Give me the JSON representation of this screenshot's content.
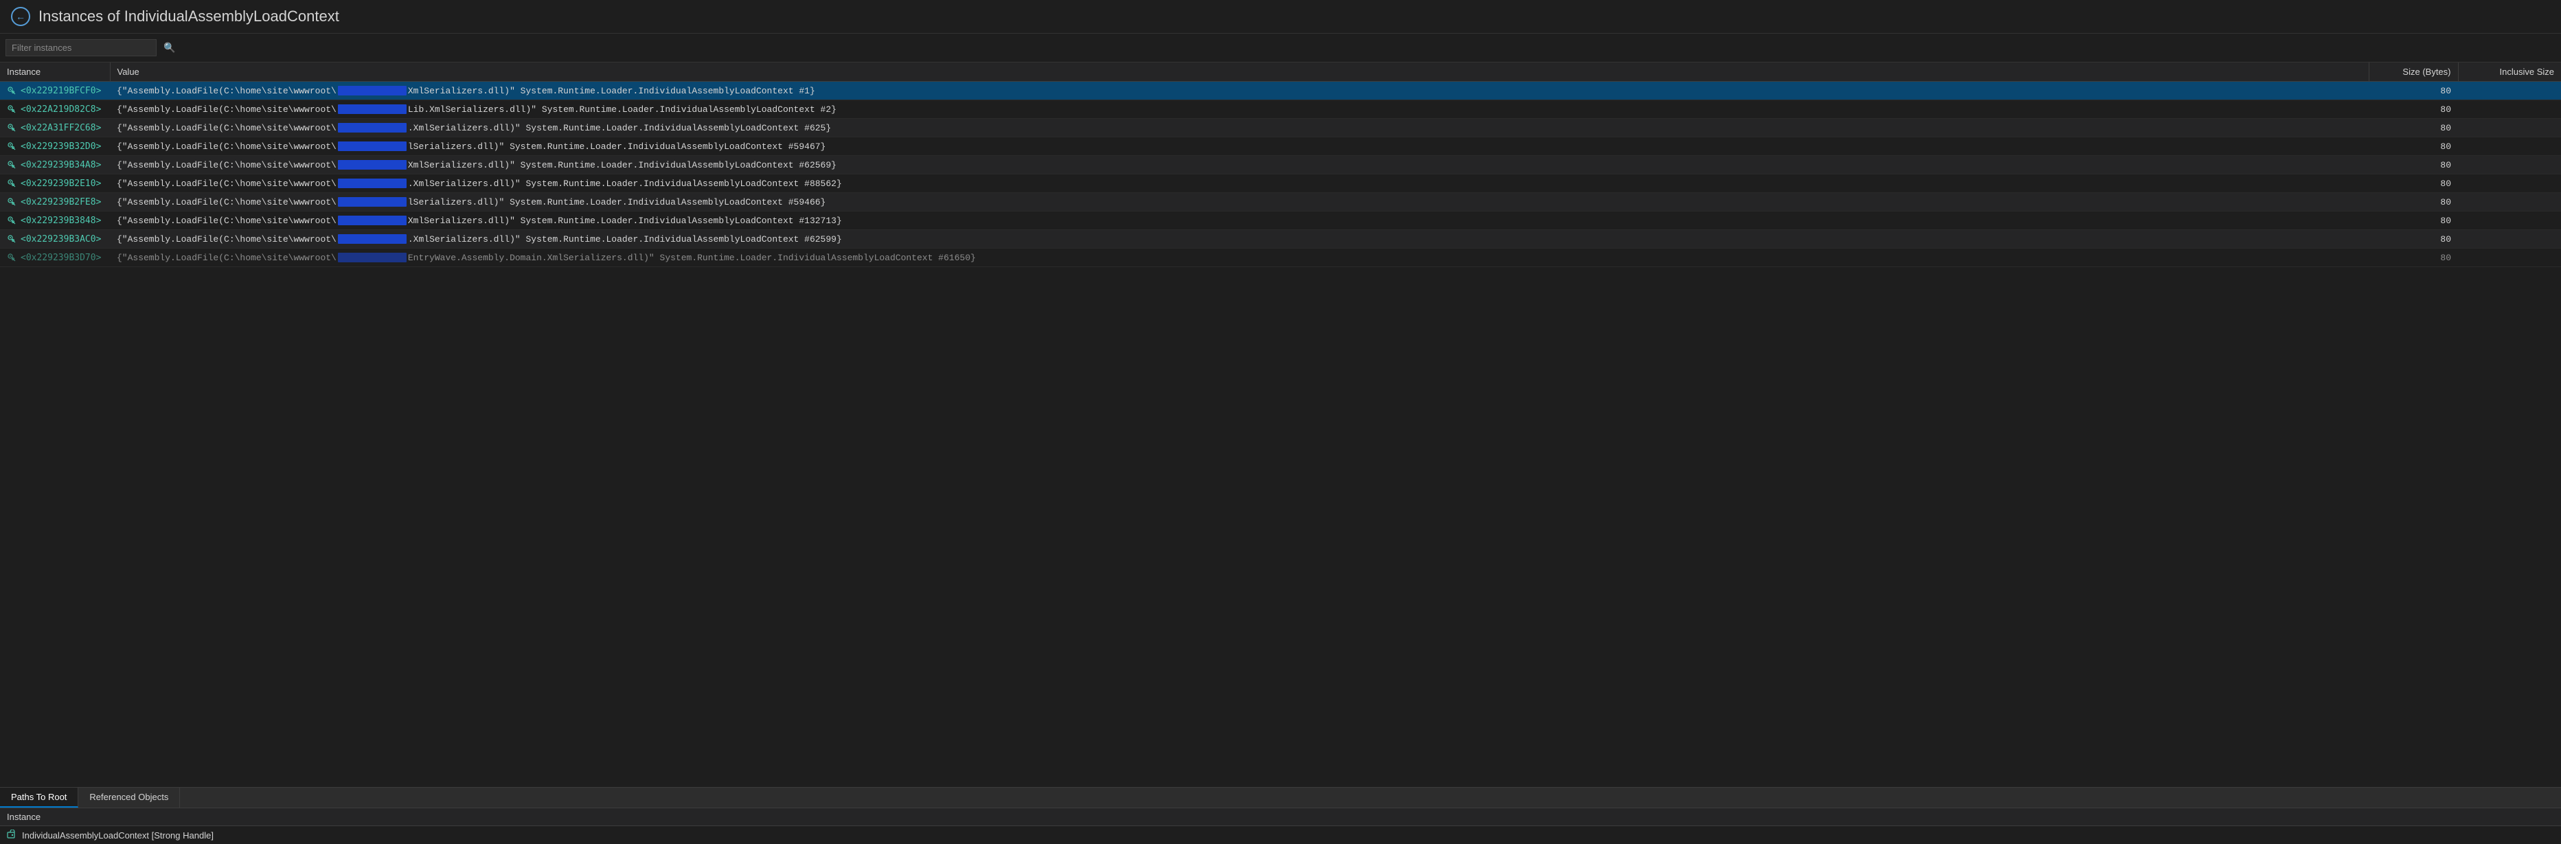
{
  "header": {
    "title": "Instances of IndividualAssemblyLoadContext",
    "back_button_label": "←"
  },
  "filter": {
    "placeholder": "Filter instances",
    "search_icon": "🔍"
  },
  "table": {
    "columns": [
      {
        "id": "instance",
        "label": "Instance"
      },
      {
        "id": "value",
        "label": "Value"
      },
      {
        "id": "size",
        "label": "Size (Bytes)"
      },
      {
        "id": "inclusive_size",
        "label": "Inclusive Size"
      }
    ],
    "rows": [
      {
        "instance": "<0x229219BFCF0>",
        "value": "{\"Assembly.LoadFile(C:\\home\\site\\wwwroot\\...XmlSerializers.dll)\" System.Runtime.Loader.IndividualAssemblyLoadContext #1}",
        "size": "80",
        "inclusive_size": "",
        "selected": true
      },
      {
        "instance": "<0x22A219D82C8>",
        "value": "{\"Assembly.LoadFile(C:\\home\\site\\wwwroot\\...Lib.XmlSerializers.dll)\" System.Runtime.Loader.IndividualAssemblyLoadContext #2}",
        "size": "80",
        "inclusive_size": "",
        "selected": false
      },
      {
        "instance": "<0x22A31FF2C68>",
        "value": "{\"Assembly.LoadFile(C:\\home\\site\\wwwroot\\....XmlSerializers.dll)\" System.Runtime.Loader.IndividualAssemblyLoadContext #625}",
        "size": "80",
        "inclusive_size": "",
        "selected": false
      },
      {
        "instance": "<0x229239B32D0>",
        "value": "{\"Assembly.LoadFile(C:\\home\\site\\wwwroot\\...lSerializers.dll)\" System.Runtime.Loader.IndividualAssemblyLoadContext #59467}",
        "size": "80",
        "inclusive_size": "",
        "selected": false
      },
      {
        "instance": "<0x229239B34A8>",
        "value": "{\"Assembly.LoadFile(C:\\home\\site\\wwwroot\\...XmlSerializers.dll)\" System.Runtime.Loader.IndividualAssemblyLoadContext #62569}",
        "size": "80",
        "inclusive_size": "",
        "selected": false
      },
      {
        "instance": "<0x229239B2E10>",
        "value": "{\"Assembly.LoadFile(C:\\home\\site\\wwwroot\\....XmlSerializers.dll)\" System.Runtime.Loader.IndividualAssemblyLoadContext #88562}",
        "size": "80",
        "inclusive_size": "",
        "selected": false
      },
      {
        "instance": "<0x229239B2FE8>",
        "value": "{\"Assembly.LoadFile(C:\\home\\site\\wwwroot\\...lSerializers.dll)\" System.Runtime.Loader.IndividualAssemblyLoadContext #59466}",
        "size": "80",
        "inclusive_size": "",
        "selected": false
      },
      {
        "instance": "<0x229239B3848>",
        "value": "{\"Assembly.LoadFile(C:\\home\\site\\wwwroot\\...XmlSerializers.dll)\" System.Runtime.Loader.IndividualAssemblyLoadContext #132713}",
        "size": "80",
        "inclusive_size": "",
        "selected": false
      },
      {
        "instance": "<0x229239B3AC0>",
        "value": "{\"Assembly.LoadFile(C:\\home\\site\\wwwroot\\....XmlSerializers.dll)\" System.Runtime.Loader.IndividualAssemblyLoadContext #62599}",
        "size": "80",
        "inclusive_size": "",
        "selected": false
      },
      {
        "instance": "<0x229239B3D70>",
        "value": "{\"Assembly.LoadFile(C:\\home\\site\\wwwroot\\...EntryWave.Assembly.Domain.XmlSerializers.dll)\" System.Runtime.Loader.IndividualAssemblyLoadContext #61650}",
        "size": "80",
        "inclusive_size": "",
        "selected": false,
        "partial": true
      }
    ]
  },
  "bottom_panel": {
    "tabs": [
      {
        "id": "paths-to-root",
        "label": "Paths To Root",
        "active": true
      },
      {
        "id": "referenced-objects",
        "label": "Referenced Objects",
        "active": false
      }
    ],
    "section_label": "Instance",
    "instance_item": {
      "text": "IndividualAssemblyLoadContext [Strong Handle]",
      "icon": "context-icon"
    }
  },
  "colors": {
    "accent_blue": "#094771",
    "tab_active_border": "#007acc",
    "instance_text": "#4ec9b0",
    "background": "#1e1e1e",
    "panel_bg": "#252526",
    "blue_bar": "#1f51d4"
  }
}
